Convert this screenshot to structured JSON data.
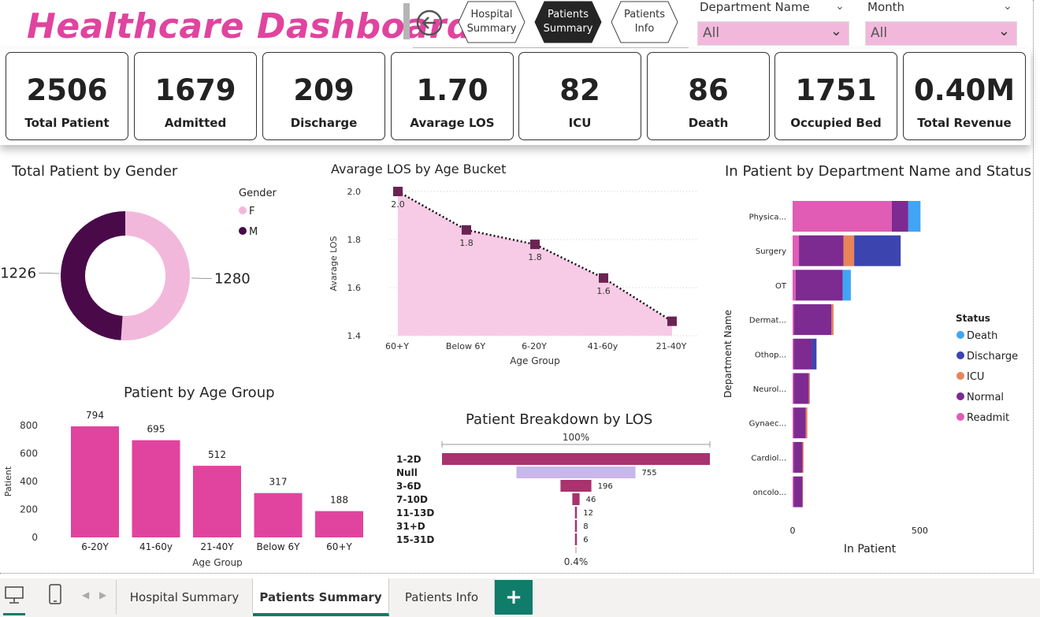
{
  "header": {
    "title": "Healthcare Dashboard",
    "nav": [
      {
        "label": "Hospital\nSummary",
        "active": false
      },
      {
        "label": "Patients\nSummary",
        "active": true
      },
      {
        "label": "Patients\nInfo",
        "active": false
      }
    ],
    "filters": [
      {
        "label": "Department Name",
        "value": "All"
      },
      {
        "label": "Month",
        "value": "All"
      }
    ]
  },
  "kpis": [
    {
      "value": "2506",
      "label": "Total Patient"
    },
    {
      "value": "1679",
      "label": "Admitted"
    },
    {
      "value": "209",
      "label": "Discharge"
    },
    {
      "value": "1.70",
      "label": "Avarage LOS"
    },
    {
      "value": "82",
      "label": "ICU"
    },
    {
      "value": "86",
      "label": "Death"
    },
    {
      "value": "1751",
      "label": "Occupied Bed"
    },
    {
      "value": "0.40M",
      "label": "Total Revenue"
    }
  ],
  "tabs": {
    "items": [
      "Hospital Summary",
      "Patients Summary",
      "Patients Info"
    ],
    "active": "Patients Summary",
    "add_label": "+"
  },
  "colors": {
    "accent": "#e0449e",
    "female": "#f2b8dc",
    "male": "#4a0a4a",
    "bar": "#e0449e",
    "funnel": "#a8336e",
    "funnel_null": "#c9b6ea",
    "death": "#41a5f5",
    "discharge": "#3c44b0",
    "icu": "#e8845a",
    "normal": "#7d2a91",
    "readmit": "#e05cb5",
    "active_tab": "#107c6a"
  },
  "chart_data": [
    {
      "id": "gender",
      "type": "pie",
      "title": "Total Patient by Gender",
      "legend_title": "Gender",
      "legend_position": "top-right",
      "labels": [
        "F",
        "M"
      ],
      "values": [
        1280,
        1226
      ]
    },
    {
      "id": "los_age",
      "type": "area",
      "title": "Avarage LOS by Age Bucket",
      "xlabel": "Age Group",
      "ylabel": "Avarage LOS",
      "categories": [
        "60+Y",
        "Below 6Y",
        "6-20Y",
        "41-60y",
        "21-40Y"
      ],
      "values": [
        2.0,
        1.84,
        1.78,
        1.64,
        1.46
      ],
      "data_labels": [
        "2.0",
        "1.8",
        "1.8",
        "1.6",
        ""
      ],
      "yticks": [
        "1.4",
        "1.6",
        "1.8",
        "2.0"
      ],
      "ylim": [
        1.4,
        2.0
      ]
    },
    {
      "id": "age_group",
      "type": "bar",
      "title": "Patient by Age Group",
      "xlabel": "Age Group",
      "ylabel": "Patient",
      "categories": [
        "6-20Y",
        "41-60y",
        "21-40Y",
        "Below 6Y",
        "60+Y"
      ],
      "values": [
        794,
        695,
        512,
        317,
        188
      ],
      "yticks": [
        "0",
        "200",
        "400",
        "600",
        "800"
      ],
      "ylim": [
        0,
        800
      ]
    },
    {
      "id": "los_funnel",
      "type": "bar",
      "title": "Patient Breakdown by LOS",
      "categories": [
        "1-2D",
        "Null",
        "3-6D",
        "7-10D",
        "11-13D",
        "31+D",
        "15-31D"
      ],
      "values": [
        1700,
        755,
        196,
        46,
        12,
        8,
        6
      ],
      "data_labels": [
        "",
        "755",
        "196",
        "46",
        "12",
        "8",
        "6"
      ],
      "top_label": "100%",
      "bottom_label": "0.4%"
    },
    {
      "id": "dept_status",
      "type": "bar",
      "title": "In Patient by Department Name and Status",
      "xlabel": "In Patient",
      "ylabel": "Department Name",
      "legend_title": "Status",
      "legend_position": "right",
      "legend": [
        "Death",
        "Discharge",
        "ICU",
        "Normal",
        "Readmit"
      ],
      "categories": [
        "Physica...",
        "Surgery",
        "OT",
        "Dermat...",
        "Othop...",
        "Neurol...",
        "Gynaec...",
        "Cardiol...",
        "oncolo..."
      ],
      "series": [
        {
          "name": "Readmit",
          "values": [
            390,
            25,
            12,
            5,
            4,
            4,
            4,
            4,
            4
          ]
        },
        {
          "name": "Normal",
          "values": [
            65,
            175,
            185,
            148,
            72,
            60,
            48,
            35,
            35
          ]
        },
        {
          "name": "ICU",
          "values": [
            0,
            42,
            0,
            8,
            0,
            4,
            6,
            4,
            2
          ]
        },
        {
          "name": "Discharge",
          "values": [
            0,
            183,
            0,
            0,
            18,
            0,
            0,
            0,
            0
          ]
        },
        {
          "name": "Death",
          "values": [
            48,
            0,
            32,
            0,
            0,
            0,
            0,
            0,
            0
          ]
        }
      ],
      "xticks": [
        "0",
        "500"
      ],
      "xlim": [
        0,
        880
      ]
    }
  ]
}
